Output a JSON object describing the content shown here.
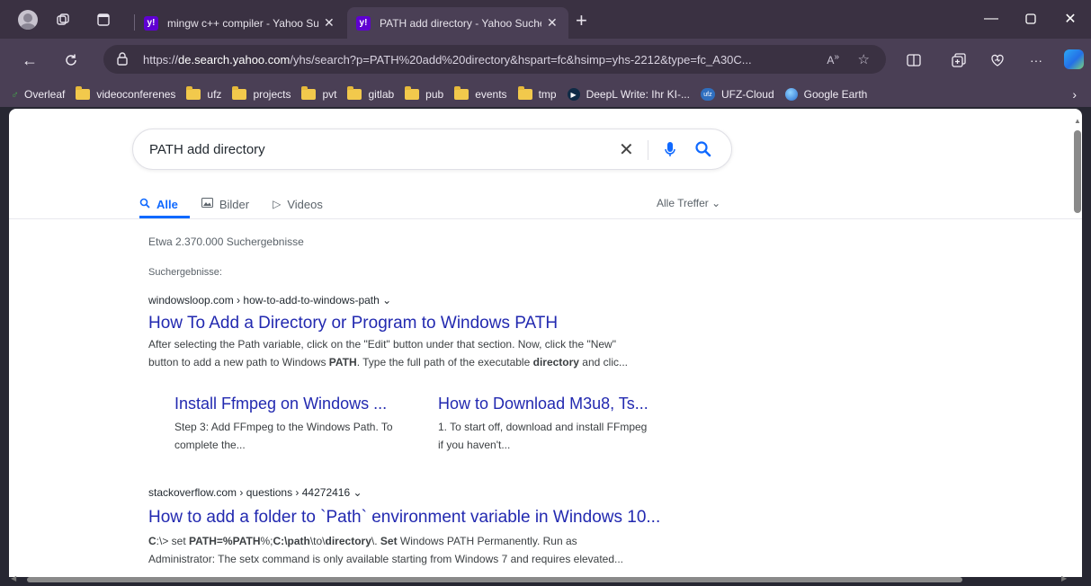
{
  "tabs": [
    {
      "title": "mingw c++ compiler - Yahoo Suche",
      "favicon": "y!",
      "active": false
    },
    {
      "title": "PATH add directory - Yahoo Suche",
      "favicon": "y!",
      "active": true
    }
  ],
  "address_bar": {
    "url_prefix": "https://",
    "url_domain": "de.search.yahoo.com",
    "url_rest": "/yhs/search?p=PATH%20add%20directory&hspart=fc&hsimp=yhs-2212&type=fc_A30C..."
  },
  "bookmarks": [
    {
      "label": "Overleaf",
      "icon": "overleaf-leaf-icon"
    },
    {
      "label": "videoconferenes",
      "icon": "folder-icon"
    },
    {
      "label": "ufz",
      "icon": "folder-icon"
    },
    {
      "label": "projects",
      "icon": "folder-icon"
    },
    {
      "label": "pvt",
      "icon": "folder-icon"
    },
    {
      "label": "gitlab",
      "icon": "folder-icon"
    },
    {
      "label": "pub",
      "icon": "folder-icon"
    },
    {
      "label": "events",
      "icon": "folder-icon"
    },
    {
      "label": "tmp",
      "icon": "folder-icon"
    },
    {
      "label": "DeepL Write: Ihr KI-...",
      "icon": "deepl-icon"
    },
    {
      "label": "UFZ-Cloud",
      "icon": "cloud-icon"
    },
    {
      "label": "Google Earth",
      "icon": "globe-icon"
    }
  ],
  "search": {
    "query": "PATH add directory"
  },
  "vertical_tabs": {
    "all": "Alle",
    "images": "Bilder",
    "videos": "Videos",
    "filter": "Alle Treffer"
  },
  "results_meta": {
    "count": "Etwa 2.370.000 Suchergebnisse",
    "label": "Suchergebnisse:"
  },
  "results": [
    {
      "domain": "windowsloop.com",
      "path": "how-to-add-to-windows-path",
      "title": "How To Add a Directory or Program to Windows PATH",
      "snippet_line1": "After selecting the Path variable, click on the \"Edit\" button under that section. Now, click the \"New\"",
      "snippet_line2_a": "button to add a new path to Windows ",
      "snippet_line2_b": "PATH",
      "snippet_line2_c": ". Type the full path of the executable ",
      "snippet_line2_d": "directory",
      "snippet_line2_e": " and clic...",
      "sublinks": [
        {
          "title": "Install Ffmpeg on Windows ...",
          "snippet": "Step 3: Add FFmpeg to the Windows Path. To complete the..."
        },
        {
          "title": "How to Download M3u8, Ts...",
          "snippet": "1. To start off, download and install FFmpeg if you haven't..."
        }
      ]
    },
    {
      "domain": "stackoverflow.com",
      "path": "questions › 44272416",
      "title": "How to add a folder to `Path` environment variable in Windows 10...",
      "snippet_line1_a": "C",
      "snippet_line1_b": ":\\> set ",
      "snippet_line1_c": "PATH=%PATH",
      "snippet_line1_d": "%;",
      "snippet_line1_e": "C:\\path",
      "snippet_line1_f": "\\to\\",
      "snippet_line1_g": "directory",
      "snippet_line1_h": "\\. ",
      "snippet_line1_i": "Set",
      "snippet_line1_j": " Windows PATH Permanently. Run as",
      "snippet_line2": "Administrator: The setx command is only available starting from Windows 7 and requires elevated..."
    }
  ],
  "colors": {
    "link": "#2229b0",
    "accent": "#0f69ff",
    "yahoo_purple": "#5f01d1"
  }
}
